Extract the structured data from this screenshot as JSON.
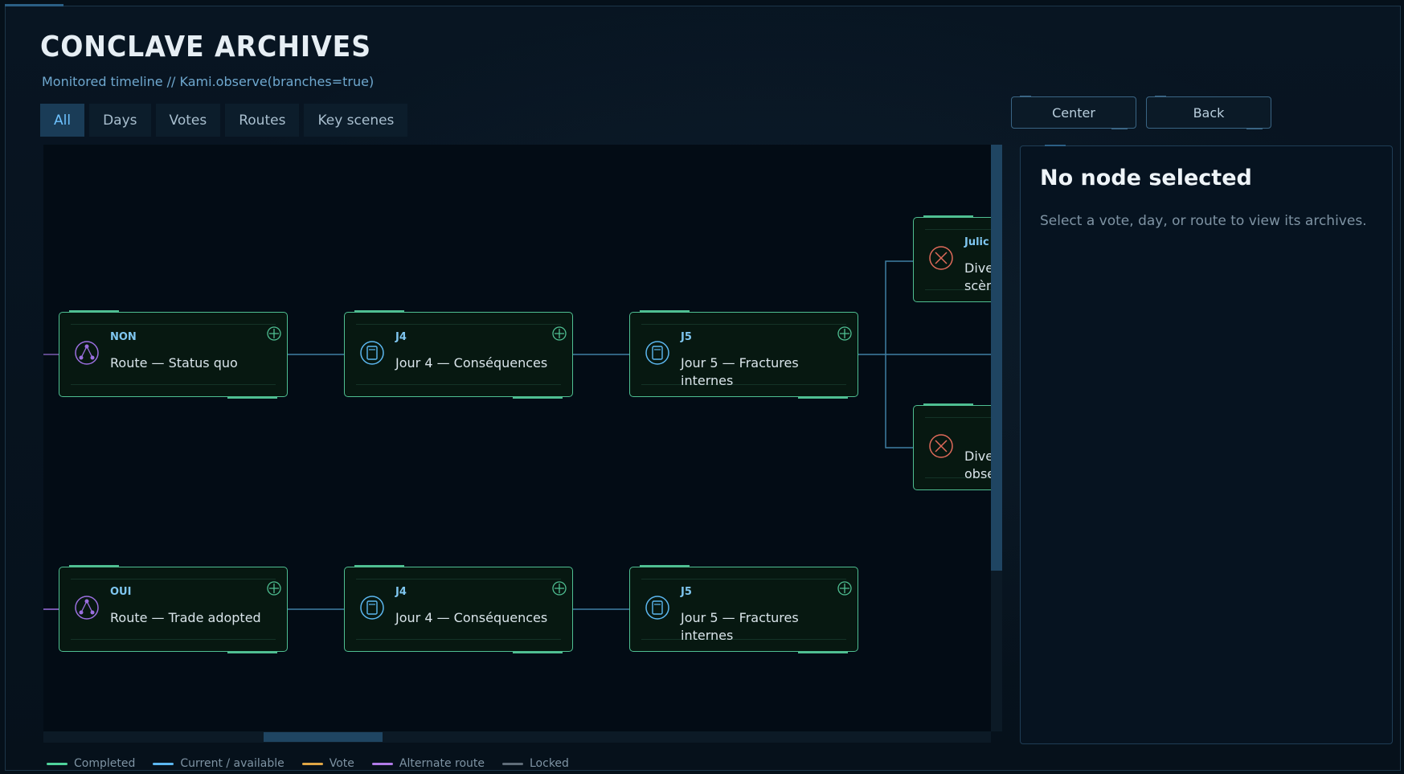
{
  "header": {
    "title": "CONCLAVE ARCHIVES",
    "subtitle": "Monitored timeline // Kami.observe(branches=true)"
  },
  "tabs": [
    {
      "label": "All",
      "active": true
    },
    {
      "label": "Days",
      "active": false
    },
    {
      "label": "Votes",
      "active": false
    },
    {
      "label": "Routes",
      "active": false
    },
    {
      "label": "Key scenes",
      "active": false
    }
  ],
  "buttons": {
    "center": "Center",
    "back": "Back"
  },
  "nodes": {
    "r1c1": {
      "tag": "NON",
      "label": "Route — Status quo",
      "icon": "route-icon"
    },
    "r1c2": {
      "tag": "J4",
      "label": "Jour 4 — Conséquences",
      "icon": "day-icon"
    },
    "r1c3": {
      "tag": "J5",
      "label": "Jour 5 — Fractures internes",
      "icon": "day-icon"
    },
    "r1c4": {
      "tag": "Julic",
      "label": "Dive scèn",
      "icon": "divergence-icon"
    },
    "r1c5": {
      "tag": "",
      "label": "Dive obse",
      "icon": "divergence-icon"
    },
    "r2c1": {
      "tag": "OUI",
      "label": "Route — Trade adopted",
      "icon": "route-icon"
    },
    "r2c2": {
      "tag": "J4",
      "label": "Jour 4 — Conséquences",
      "icon": "day-icon"
    },
    "r2c3": {
      "tag": "J5",
      "label": "Jour 5 — Fractures internes",
      "icon": "day-icon"
    }
  },
  "panel": {
    "title": "No node selected",
    "subtitle": "Select a vote, day, or route to view its archives."
  },
  "legend": [
    {
      "label": "Completed",
      "color": "#4fd39b"
    },
    {
      "label": "Current / available",
      "color": "#5cb7f0"
    },
    {
      "label": "Vote",
      "color": "#e0a645"
    },
    {
      "label": "Alternate route",
      "color": "#b07ae8"
    },
    {
      "label": "Locked",
      "color": "#5f6c78"
    }
  ],
  "colors": {
    "completed": "#4fbf92",
    "link": "#3f7ea3",
    "alt": "#9b6fe0",
    "danger": "#e06a5a",
    "accent": "#6ec2ff"
  }
}
